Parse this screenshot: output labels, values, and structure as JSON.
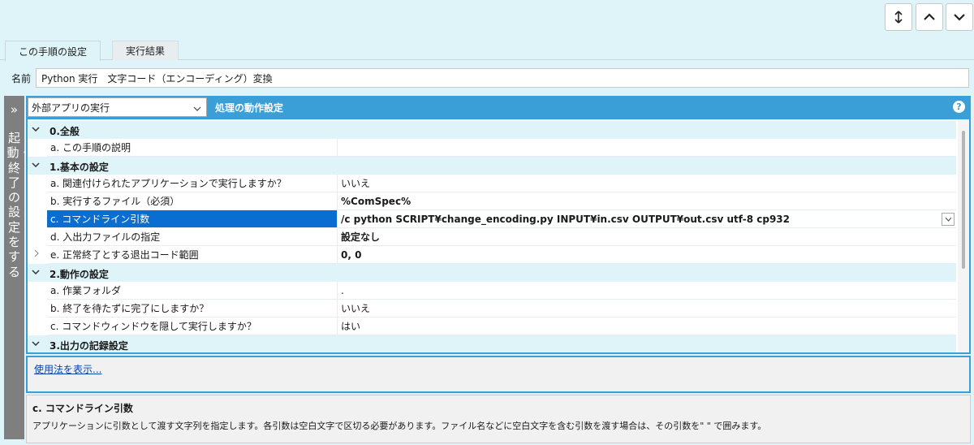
{
  "toolbar": {
    "resize_icon": "vertical-resize-icon",
    "up_icon": "chevron-up-icon",
    "down_icon": "chevron-down-icon"
  },
  "tabs": [
    {
      "label": "この手順の設定",
      "active": true
    },
    {
      "label": "実行結果",
      "active": false
    }
  ],
  "name": {
    "label": "名前",
    "value": "Python 実行　文字コード（エンコーディング）変換"
  },
  "side_panel": {
    "chevron": "»",
    "label": "起動・終了の設定をする"
  },
  "panel": {
    "select_value": "外部アプリの実行",
    "title": "処理の動作設定",
    "help_icon": "?"
  },
  "sections": [
    {
      "label": "0.全般",
      "items": [
        {
          "prop": "a. この手順の説明",
          "value": ""
        }
      ]
    },
    {
      "label": "1.基本の設定",
      "items": [
        {
          "prop": "a. 関連付けられたアプリケーションで実行しますか？",
          "value": "いいえ"
        },
        {
          "prop": "b. 実行するファイル（必須）",
          "value": "%ComSpec%"
        },
        {
          "prop": "c. コマンドライン引数",
          "value": "/c python SCRIPT¥change_encoding.py INPUT¥in.csv OUTPUT¥out.csv utf-8 cp932"
        },
        {
          "prop": "d. 入出力ファイルの指定",
          "value": "設定なし"
        },
        {
          "prop": "e. 正常終了とする退出コード範囲",
          "value": "0, 0"
        }
      ]
    },
    {
      "label": "2.動作の設定",
      "items": [
        {
          "prop": "a. 作業フォルダ",
          "value": "."
        },
        {
          "prop": "b. 終了を待たずに完了にしますか？",
          "value": "いいえ"
        },
        {
          "prop": "c. コマンドウィンドウを隠して実行しますか？",
          "value": "はい"
        }
      ]
    },
    {
      "label": "3.出力の記録設定",
      "items": []
    }
  ],
  "usage_link": "使用法を表示...",
  "description": {
    "title": "c. コマンドライン引数",
    "text": "アプリケーションに引数として渡す文字列を指定します。各引数は空白文字で区切る必要があります。ファイル名などに空白文字を含む引数を渡す場合は、その引数を\" \" で囲みます。"
  },
  "colors": {
    "accent": "#3a9fd6",
    "selection": "#0a6ed1",
    "background": "#dff4f9"
  }
}
